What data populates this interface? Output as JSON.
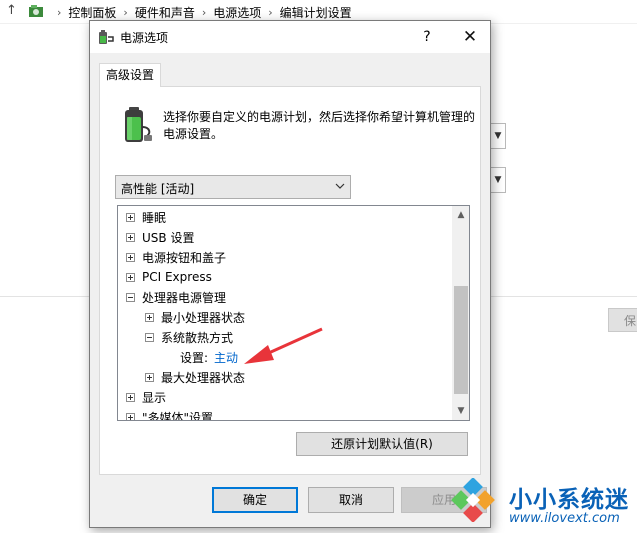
{
  "explorer": {
    "breadcrumbs": [
      "控制面板",
      "硬件和声音",
      "电源选项",
      "编辑计划设置"
    ],
    "save_label": "保"
  },
  "dialog": {
    "title": "电源选项",
    "help": "?",
    "close": "✕",
    "tab": "高级设置",
    "description": "选择你要自定义的电源计划，然后选择你希望计算机管理的电源设置。",
    "plan_select": "高性能 [活动]",
    "tree": [
      {
        "label": "睡眠",
        "expander": "plus",
        "level": 0
      },
      {
        "label": "USB 设置",
        "expander": "plus",
        "level": 0
      },
      {
        "label": "电源按钮和盖子",
        "expander": "plus",
        "level": 0
      },
      {
        "label": "PCI Express",
        "expander": "plus",
        "level": 0
      },
      {
        "label": "处理器电源管理",
        "expander": "minus",
        "level": 0
      },
      {
        "label": "最小处理器状态",
        "expander": "plus",
        "level": 1
      },
      {
        "label": "系统散热方式",
        "expander": "minus",
        "level": 1
      },
      {
        "label": "设置:",
        "value": "主动",
        "expander": "none",
        "level": 2
      },
      {
        "label": "最大处理器状态",
        "expander": "plus",
        "level": 1
      },
      {
        "label": "显示",
        "expander": "plus",
        "level": 0
      },
      {
        "label": "\"多媒体\"设置",
        "expander": "plus",
        "level": 0
      }
    ],
    "restore_button": "还原计划默认值(R)",
    "ok": "确定",
    "cancel": "取消",
    "apply": "应用"
  },
  "watermark": {
    "title": "小小系统迷",
    "url": "www.ilovext.com"
  },
  "colors": {
    "accent": "#0078d7",
    "link": "#0066cc",
    "annotation_arrow": "#e8343a",
    "watermark": "#0a62b7"
  }
}
